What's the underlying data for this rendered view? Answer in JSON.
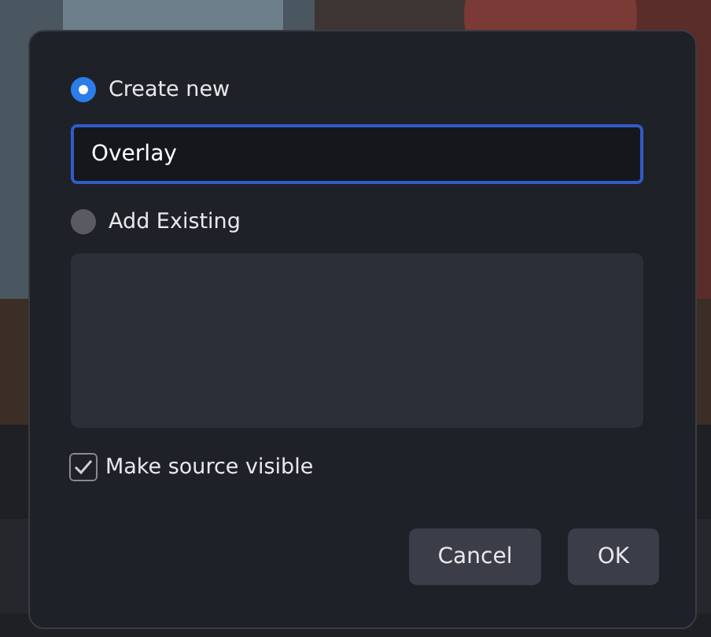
{
  "options": [
    {
      "label": "Create new",
      "selected": true
    },
    {
      "label": "Add Existing",
      "selected": false
    }
  ],
  "name_field": {
    "value": "Overlay",
    "focused": true
  },
  "visible_checkbox": {
    "label": "Make source visible",
    "checked": true
  },
  "buttons": [
    {
      "label": "Cancel",
      "kind": "secondary"
    },
    {
      "label": "OK",
      "kind": "primary"
    }
  ]
}
